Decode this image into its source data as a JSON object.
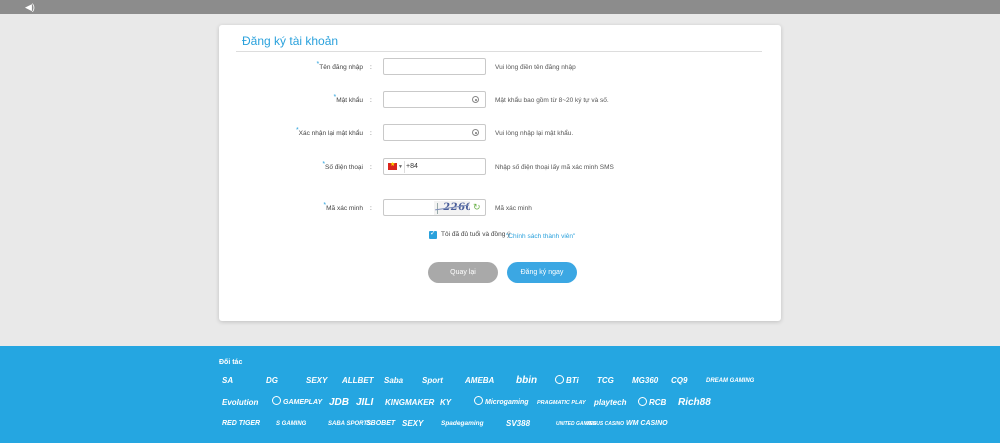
{
  "topbar": {
    "icon": "speaker-icon"
  },
  "form": {
    "title": "Đăng ký tài khoản",
    "fields": [
      {
        "label": "Tên đăng nhập",
        "hint": "Vui lòng điền tên đăng nhập",
        "value": "",
        "type": "text"
      },
      {
        "label": "Mật khẩu",
        "hint": "Mật khẩu bao gồm từ 8~20 ký tự và số.",
        "value": "",
        "type": "password"
      },
      {
        "label": "Xác nhận lại mật khẩu",
        "hint": "Vui lòng nhập lại mật khẩu.",
        "value": "",
        "type": "password"
      },
      {
        "label": "Số điện thoại",
        "hint": "Nhập số điện thoại lấy mã xác minh SMS",
        "value": "",
        "type": "phone",
        "country_code": "+84"
      },
      {
        "label": "Mã xác minh",
        "hint": "Mã xác minh",
        "value": "",
        "type": "captcha",
        "captcha_text": "2260"
      }
    ],
    "agree_text": "Tôi đã đủ tuổi và đồng ý",
    "agree_link": "\"Chính sách thành viên\"",
    "agree_checked": true,
    "back_button": "Quay lại",
    "register_button": "Đăng ký ngay"
  },
  "footer": {
    "title": "Đối tác",
    "partner_rows": [
      [
        "SA",
        "DG",
        "SEXY",
        "ALLBET",
        "Saba",
        "Sport",
        "AMEBA",
        "bbin",
        "BTi",
        "TCG",
        "MG360",
        "CQ9",
        "DREAM GAMING"
      ],
      [
        "Evolution",
        "GAMEPLAY",
        "JDB",
        "JILI",
        "KINGMAKER",
        "KY",
        "Microgaming",
        "PRAGMATIC PLAY",
        "playtech",
        "RCB",
        "Rich88"
      ],
      [
        "RED TIGER",
        "S GAMING",
        "SABA SPORTS",
        "SBOBET",
        "SEXY",
        "Spadegaming",
        "SV388",
        "UNITED GAMING",
        "VENUS CASINO",
        "WM CASINO"
      ]
    ]
  },
  "colors": {
    "accent": "#2aa1dc",
    "footer_bg": "#25a6e1",
    "back_button": "#a9a9a9"
  }
}
